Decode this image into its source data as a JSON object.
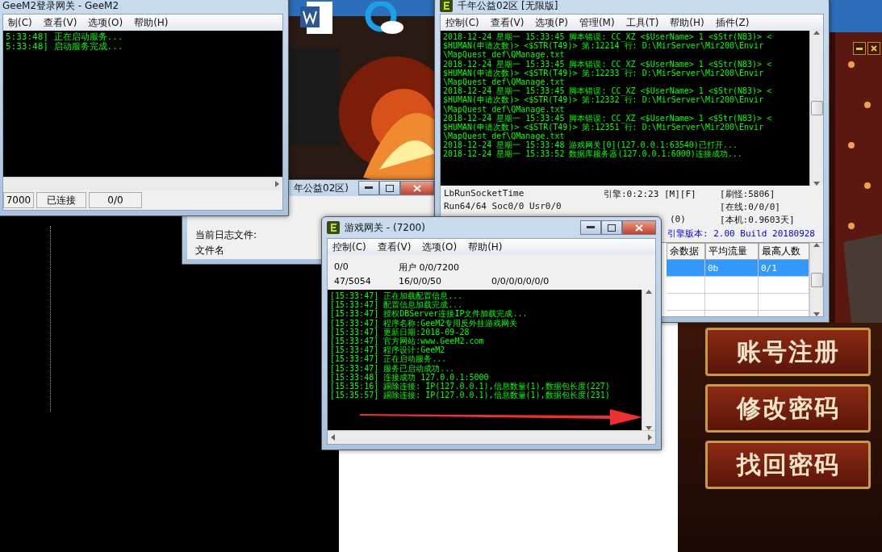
{
  "login_gateway": {
    "title": "GeeM2登录网关 - GeeM2",
    "menu": [
      "制(C)",
      "查看(V)",
      "选项(O)",
      "帮助(H)"
    ],
    "log": [
      "5:33:48] 正在启动服务...",
      "5:33:48] 启动服务完成..."
    ],
    "status": [
      "7000",
      "已连接",
      "0/0"
    ]
  },
  "server_window": {
    "title": "千年公益02区 [无限版]",
    "menu": [
      "控制(C)",
      "查看(V)",
      "选项(P)",
      "管理(M)",
      "工具(T)",
      "帮助(H)",
      "插件(Z)"
    ],
    "log": [
      "2018-12-24 星期一 15:33:45 脚本错误: CC_XZ <$UserName> 1 <$Str(N83)> <",
      "$HUMAN(申请次数)> <$STR(T49)> 第:12214 行: D:\\MirServer\\Mir200\\Envir",
      "\\MapQuest_def\\QManage.txt",
      "2018-12-24 星期一 15:33:45 脚本错误: CC_XZ <$UserName> 1 <$Str(N83)> <",
      "$HUMAN(申请次数)> <$STR(T49)> 第:12233 行: D:\\MirServer\\Mir200\\Envir",
      "\\MapQuest_def\\QManage.txt",
      "2018-12-24 星期一 15:33:45 脚本错误: CC_XZ <$UserName> 1 <$Str(N83)> <",
      "$HUMAN(申请次数)> <$STR(T49)> 第:12332 行: D:\\MirServer\\Mir200\\Envir",
      "\\MapQuest_def\\QManage.txt",
      "2018-12-24 星期一 15:33:45 脚本错误: CC_XZ <$UserName> 1 <$Str(N83)> <",
      "$HUMAN(申请次数)> <$STR(T49)> 第:12351 行: D:\\MirServer\\Mir200\\Envir",
      "\\MapQuest_def\\QManage.txt",
      "2018-12-24 星期一 15:33:48 游戏网关[0](127.0.0.1:63540)已打开...",
      "2018-12-24 星期一 15:33:52 数据库服务器(127.0.0.1:6000)连接成功..."
    ],
    "info_left": [
      "LbRunSocketTime",
      "Run64/64 Soc0/0 Usr0/0"
    ],
    "engine": "引擎:0:2:23 [M][F]",
    "extra": "(0)",
    "info_right": [
      "[刷怪:5806]",
      "[在线:0/0/0]",
      "[本机:0.9603天]"
    ],
    "version": "引擎版本: 2.00 Build 20180928",
    "table": {
      "columns": [
        "余数据",
        "平均流量",
        "最高人数"
      ],
      "rows": [
        {
          "cells": [
            "",
            "0b",
            "0/1"
          ],
          "selected": true
        },
        {
          "cells": [
            "",
            "",
            ""
          ],
          "selected": false
        },
        {
          "cells": [
            "",
            "",
            ""
          ],
          "selected": false
        },
        {
          "cells": [
            "",
            "",
            ""
          ],
          "selected": false
        }
      ]
    }
  },
  "log_window": {
    "title": "年公益02区)",
    "labels": [
      "当前日志文件:",
      "文件名"
    ]
  },
  "game_gateway": {
    "title": "游戏网关 - (7200)",
    "menu": [
      "控制(C)",
      "查看(V)",
      "选项(O)",
      "帮助(H)"
    ],
    "stats": [
      [
        "0/0",
        "用户 0/0/7200"
      ],
      [
        "47/5054",
        "16/0/0/50",
        "0/0/0/0/0/0/0"
      ]
    ],
    "log": [
      "[15:33:47] 正在加载配置信息...",
      "[15:33:47] 配置信息加载完成...",
      "[15:33:47] 授权DBServer连接IP文件加载完成...",
      "[15:33:47] 程序名称:GeeM2专用反外挂游戏网关",
      "[15:33:47] 更新日期:2018-09-28",
      "[15:33:47] 官方网站:www.GeeM2.com",
      "[15:33:47] 程序设计:GeeM2",
      "[15:33:47] 正在启动服务...",
      "[15:33:47] 服务已启动成功...",
      "[15:33:48] 连接成功 127.0.0.1:5000",
      "[15:35:16] 踢除连接: IP(127.0.0.1),信息数量(1),数据包长度(227)",
      "[15:35:57] 踢除连接: IP(127.0.0.1),信息数量(1),数据包长度(231)"
    ]
  },
  "launcher": {
    "buttons": [
      "账号注册",
      "修改密码",
      "找回密码"
    ]
  }
}
